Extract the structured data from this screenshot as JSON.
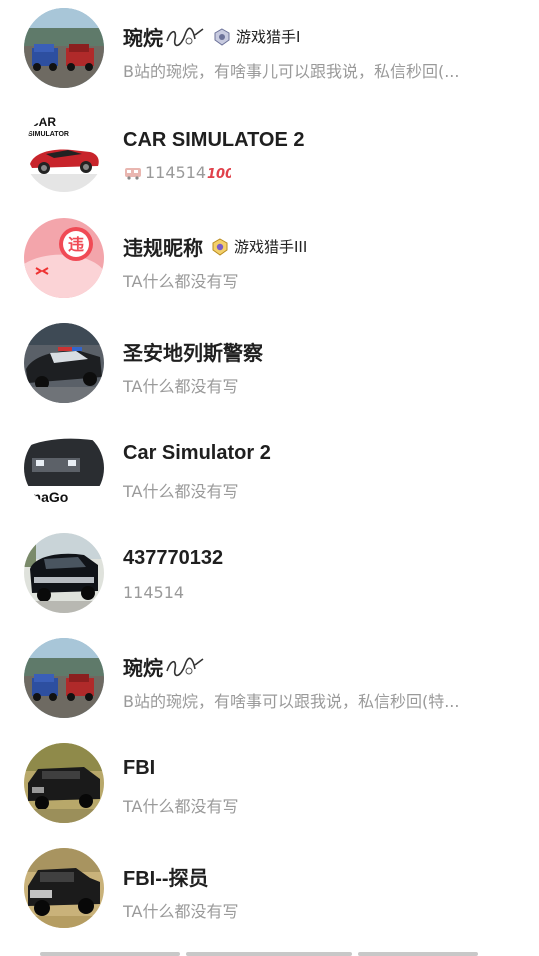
{
  "users": [
    {
      "name": "琬烷",
      "deco": "signature-flourish",
      "badge": "游戏猎手I",
      "signature": "B站的琬烷，有啥事儿可以跟我说，私信秒回(...",
      "avatar": "two-cars-dirt"
    },
    {
      "name": "CAR SIMULATOE 2",
      "deco": "",
      "badge": "",
      "signature": "114514",
      "signature_prefix_icon": "train-icon",
      "signature_suffix_icon": "hundred-emoji",
      "avatar": "car-simulator-logo"
    },
    {
      "name": "违规昵称",
      "deco": "",
      "badge": "游戏猎手III",
      "signature": "TA什么都没有写",
      "avatar": "violation-placeholder",
      "violation_label": "违"
    },
    {
      "name": "圣安地列斯警察",
      "deco": "",
      "badge": "",
      "signature": "TA什么都没有写",
      "avatar": "police-car"
    },
    {
      "name": "Car Simulator 2",
      "deco": "",
      "badge": "",
      "signature": "TA什么都没有写",
      "avatar": "dark-suv"
    },
    {
      "name": "437770132",
      "deco": "",
      "badge": "",
      "signature": "114514",
      "avatar": "black-suv-road"
    },
    {
      "name": "琬烷",
      "deco": "signature-flourish",
      "badge": "",
      "signature": "B站的琬烷，有啥事可以跟我说，私信秒回(特...",
      "avatar": "two-cars-dirt"
    },
    {
      "name": "FBI",
      "deco": "",
      "badge": "",
      "signature": "TA什么都没有写",
      "avatar": "black-sedan"
    },
    {
      "name": "FBI--探员",
      "deco": "",
      "badge": "",
      "signature": "TA什么都没有写",
      "avatar": "black-truck"
    }
  ],
  "colors": {
    "name": "#1f1f1f",
    "signature": "#9a9a9a",
    "violation": "#f04a55"
  }
}
